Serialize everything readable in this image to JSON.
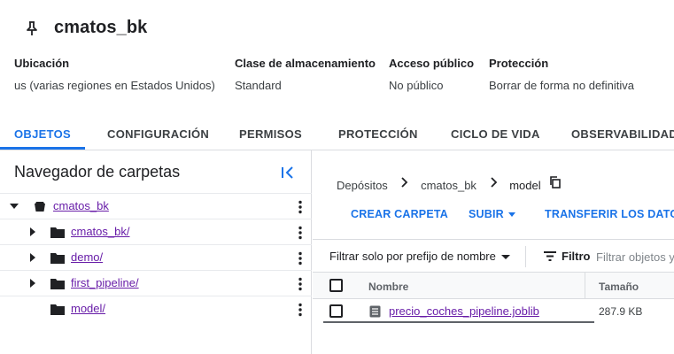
{
  "bucket": {
    "name": "cmatos_bk"
  },
  "info": [
    {
      "label": "Ubicación",
      "value": "us (varias regiones en Estados Unidos)"
    },
    {
      "label": "Clase de almacenamiento",
      "value": "Standard"
    },
    {
      "label": "Acceso público",
      "value": "No público"
    },
    {
      "label": "Protección",
      "value": "Borrar de forma no definitiva"
    }
  ],
  "tabs": [
    {
      "label": "OBJETOS",
      "active": true
    },
    {
      "label": "CONFIGURACIÓN"
    },
    {
      "label": "PERMISOS"
    },
    {
      "label": "PROTECCIÓN"
    },
    {
      "label": "CICLO DE VIDA"
    },
    {
      "label": "OBSERVABILIDAD"
    }
  ],
  "folder_nav": {
    "title": "Navegador de carpetas",
    "items": [
      {
        "name": "cmatos_bk",
        "type": "bucket",
        "expanded": true
      },
      {
        "name": "cmatos_bk/",
        "type": "folder"
      },
      {
        "name": "demo/",
        "type": "folder"
      },
      {
        "name": "first_pipeline/",
        "type": "folder"
      },
      {
        "name": "model/",
        "type": "folder"
      }
    ]
  },
  "breadcrumb": {
    "root": "Depósitos",
    "bucket": "cmatos_bk",
    "current": "model"
  },
  "actions": {
    "create_folder": "CREAR CARPETA",
    "upload": "SUBIR",
    "transfer": "TRANSFERIR LOS DATOS"
  },
  "filter": {
    "prefix_label": "Filtrar solo por prefijo de nombre",
    "filter_label": "Filtro",
    "placeholder": "Filtrar objetos y carpetas"
  },
  "table": {
    "columns": [
      "Nombre",
      "Tamaño"
    ],
    "rows": [
      {
        "name": "precio_coches_pipeline.joblib",
        "size": "287.9 KB"
      }
    ]
  },
  "colors": {
    "accent": "#1a73e8",
    "visited_link": "#681da8"
  }
}
